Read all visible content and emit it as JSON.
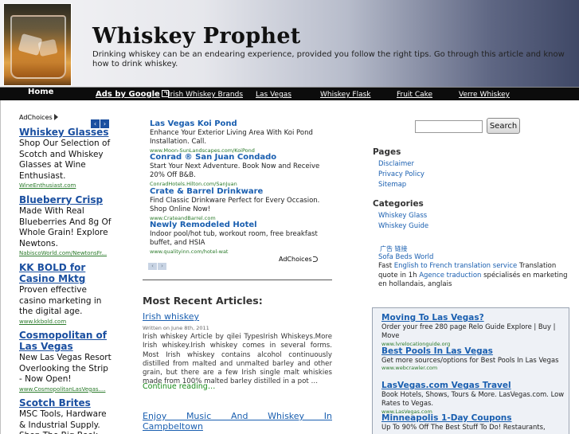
{
  "header": {
    "title": "Whiskey Prophet",
    "description": "Drinking whiskey can be an endearing experience, provided you follow the right tips. Go through this article and know how to drink whiskey."
  },
  "nav": {
    "home": "Home"
  },
  "ads_row": {
    "label": "Ads by Google",
    "links": [
      "Irish Whiskey Brands",
      "Las Vegas",
      "Whiskey Flask",
      "Fruit Cake",
      "Verre Whiskey"
    ]
  },
  "left_ads": {
    "adchoices": "AdChoices",
    "prev": "‹",
    "next": "›",
    "items": [
      {
        "title": "Whiskey Glasses",
        "desc": "Shop Our Selection of Scotch and Whiskey Glasses at Wine Enthusiast.",
        "url": "WineEnthusiast.com"
      },
      {
        "title": "Blueberry Crisp",
        "desc": "Made With Real Blueberries And 8g Of Whole Grain! Explore Newtons.",
        "url": "NabiscoWorld.com/NewtonsFr..."
      },
      {
        "title": "KK BOLD for Casino Mktg",
        "desc": "Proven effective casino marketing in the digital age.",
        "url": "www.kkbold.com"
      },
      {
        "title": "Cosmopolitan of Las Vegas",
        "desc": "New Las Vegas Resort Overlooking the Strip - Now Open!",
        "url": "www.CosmopolitanLasVegas...."
      },
      {
        "title": "Scotch Brites",
        "desc": "MSC Tools, Hardware & Industrial Supply. Shop The Big Book",
        "url": ""
      }
    ]
  },
  "main_ads": {
    "items": [
      {
        "title": "Las Vegas Koi Pond",
        "desc": "Enhance Your Exterior Living Area With Koi Pond Installation. Call.",
        "url": "www.Moon-SunLandscapes.com/KoiPond"
      },
      {
        "title": "Conrad ® San Juan Condado",
        "desc": "Start Your Next Adventure. Book Now and Receive 20% Off B&B.",
        "url": "ConradHotels.Hilton.com/SanJuan"
      },
      {
        "title": "Crate & Barrel Drinkware",
        "desc": "Find Classic Drinkware Perfect for Every Occasion. Shop Online Now!",
        "url": "www.CrateandBarrel.com"
      },
      {
        "title": "Newly Remodeled Hotel",
        "desc": "Indoor pool/hot tub, workout room, free breakfast buffet, and HSIA",
        "url": "www.qualityinn.com/hotel-wat"
      }
    ],
    "adchoices": "AdChoices",
    "prev": "‹",
    "next": "›"
  },
  "articles": {
    "heading": "Most Recent Articles:",
    "posts": [
      {
        "title": "Irish whiskey",
        "date": "Written on June 8th, 2011",
        "excerpt": "Irish whiskey Article by qilei TypesIrish Whiskeys.More Irish whiskey.Irish whiskey comes in several forms. Most Irish whiskey contains alcohol continuously distilled from malted and unmalted barley and other grain, but there are a few Irish single malt whiskies made from 100% malted barley distilled in a pot …",
        "continue": "Continue reading…"
      },
      {
        "title_line1": "Enjoy Music And Whiskey In",
        "title_line2": "Campbeltown"
      }
    ]
  },
  "sidebar": {
    "search_placeholder": "",
    "search_button": "Search",
    "pages_heading": "Pages",
    "pages": [
      "Disclaimer",
      "Privacy Policy",
      "Sitemap"
    ],
    "categories_heading": "Categories",
    "categories": [
      "Whiskey Glass",
      "Whiskey Guide"
    ],
    "ad_icon_text": "广告 链接",
    "sofa": "Sofa Beds World",
    "translation_prefix": "Fast ",
    "translation_link": "English to French translation service",
    "translation_suffix": " Translation quote in 1h ",
    "agence_link": "Agence traduction",
    "agence_suffix": " spécialisés en marketing en hollandais, anglais"
  },
  "right_ads": [
    {
      "title": "Moving To Las Vegas?",
      "desc": "Order your free 280 page Relo Guide Explore | Buy | Move",
      "url": "www.lvrelocationguide.org"
    },
    {
      "title": "Best Pools In Las Vegas",
      "desc": "Get more sources/options for Best Pools In Las Vegas",
      "url": "www.webcrawler.com"
    },
    {
      "title": "LasVegas.com Vegas Travel",
      "desc": "Book Hotels, Shows, Tours & More. LasVegas.com. Low Rates to Vegas.",
      "url": "www.LasVegas.com"
    },
    {
      "title": "Minneapolis 1-Day Coupons",
      "desc": "Up To 90% Off The Best Stuff To Do! Restaurants,",
      "url": ""
    }
  ],
  "colors": {
    "link": "#1a5fb0",
    "url_green": "#2a7a2a",
    "nav_bg": "#0c0c0c"
  }
}
